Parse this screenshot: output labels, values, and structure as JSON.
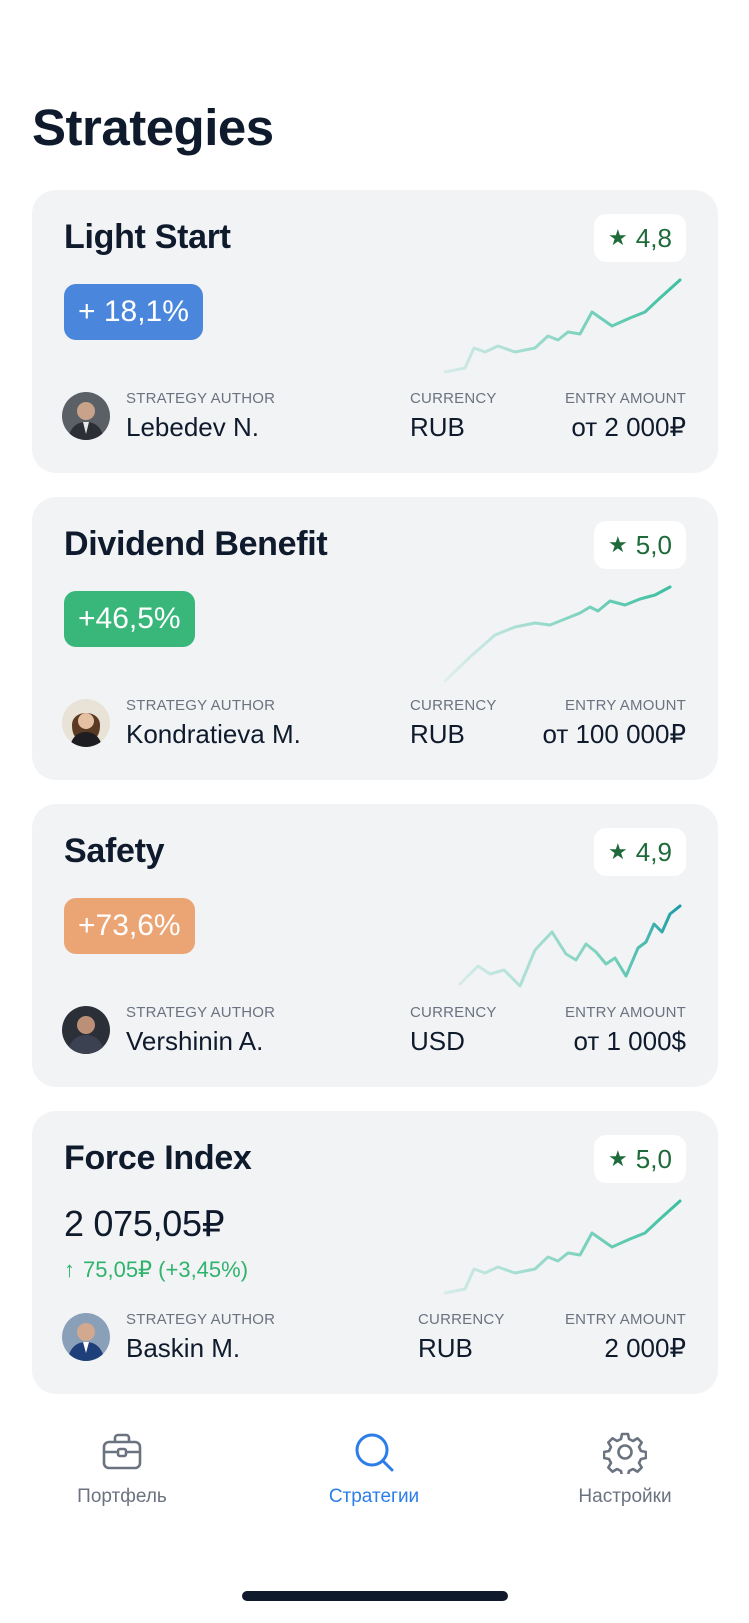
{
  "page": {
    "title": "Strategies"
  },
  "strategies": [
    {
      "name": "Light Start",
      "rating": "4,8",
      "return_label": "+ 18,1%",
      "author_label": "STRATEGY AUTHOR",
      "author": "Lebedev N.",
      "currency_label": "CURRENCY",
      "currency": "RUB",
      "entry_label": "ENTRY AMOUNT",
      "entry_amount": "от 2 000₽"
    },
    {
      "name": "Dividend Benefit",
      "rating": "5,0",
      "return_label": "+46,5%",
      "author_label": "STRATEGY AUTHOR",
      "author": "Kondratieva M.",
      "currency_label": "CURRENCY",
      "currency": "RUB",
      "entry_label": "ENTRY AMOUNT",
      "entry_amount": "от 100 000₽"
    },
    {
      "name": "Safety",
      "rating": "4,9",
      "return_label": "+73,6%",
      "author_label": "STRATEGY AUTHOR",
      "author": "Vershinin A.",
      "currency_label": "CURRENCY",
      "currency": "USD",
      "entry_label": "ENTRY AMOUNT",
      "entry_amount": "от 1 000$"
    },
    {
      "name": "Force Index",
      "rating": "5,0",
      "price": "2 075,05₽",
      "change": "75,05₽ (+3,45%)",
      "author_label": "STRATEGY AUTHOR",
      "author": "Baskin M.",
      "currency_label": "CURRENCY",
      "currency": "RUB",
      "entry_label": "ENTRY AMOUNT",
      "entry_amount": "2 000₽"
    }
  ],
  "tabs": [
    {
      "label": "Портфель",
      "icon": "briefcase-icon",
      "active": false
    },
    {
      "label": "Стратегии",
      "icon": "search-icon",
      "active": true
    },
    {
      "label": "Настройки",
      "icon": "gear-icon",
      "active": false
    }
  ],
  "colors": {
    "badge_blue": "#4a86dc",
    "badge_green": "#39b77a",
    "badge_orange": "#eba575",
    "rating_green": "#1e6a3a",
    "change_green": "#2fb36d",
    "active_tab": "#2b7de9",
    "sparkline": "#3cc0a0"
  }
}
